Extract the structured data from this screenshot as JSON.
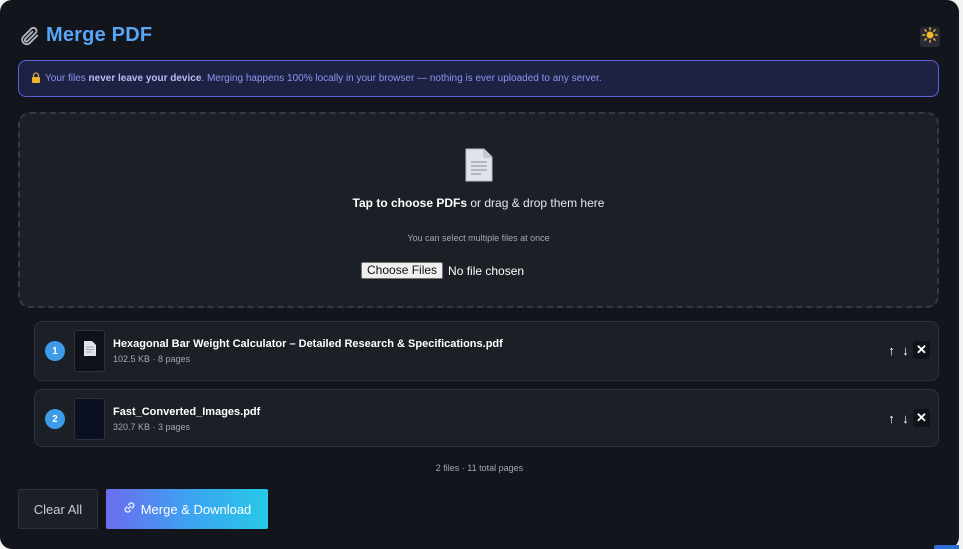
{
  "header": {
    "title": "Merge PDF",
    "clip_icon": "paperclip-icon",
    "theme_icon": "sun-icon"
  },
  "notice": {
    "lock_icon": "lock-icon",
    "text_before": "Your files ",
    "text_bold": "never leave your device",
    "text_after": ". Merging happens 100% locally in your browser — nothing is ever uploaded to any server."
  },
  "dropzone": {
    "icon": "document-icon",
    "main_bold": "Tap to choose PDFs",
    "main_rest": " or drag & drop them here",
    "sub": "You can select multiple files at once",
    "choose_label": "Choose Files",
    "no_file": "No file chosen"
  },
  "files": [
    {
      "index": "1",
      "name": "Hexagonal Bar Weight Calculator – Detailed Research & Specifications.pdf",
      "meta": "102.5 KB · 8 pages",
      "up": "↑",
      "down": "↓",
      "remove": "✕"
    },
    {
      "index": "2",
      "name": "Fast_Converted_Images.pdf",
      "meta": "320.7 KB · 3 pages",
      "up": "↑",
      "down": "↓",
      "remove": "✕"
    }
  ],
  "summary": "2 files · 11 total pages",
  "buttons": {
    "clear": "Clear All",
    "merge": "Merge & Download",
    "merge_icon": "link-icon"
  },
  "colors": {
    "accent": "#58a6f5",
    "background": "#12151c",
    "notice_border": "#5b63d9"
  }
}
